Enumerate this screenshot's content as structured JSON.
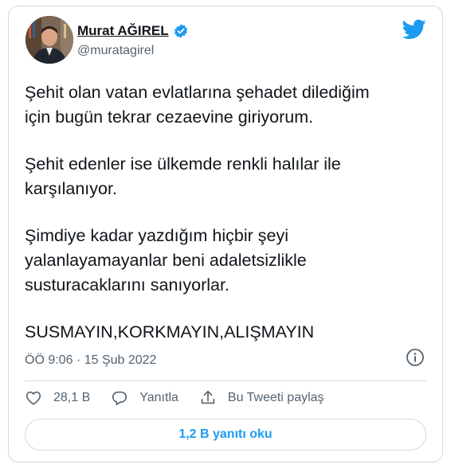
{
  "tweet": {
    "author_name": "Murat AĞIREL",
    "handle": "@muratagirel",
    "paragraphs": [
      "Şehit olan vatan evlatlarına şehadet dilediğim\niçin bugün tekrar cezaevine giriyorum.",
      "Şehit edenler ise ülkemde renkli halılar ile\nkarşılanıyor.",
      "Şimdiye kadar yazdığım hiçbir şeyi\nyalanlayamayanlar beni adaletsizlikle\nsusturacaklarını sanıyorlar.",
      "SUSMAYIN,KORKMAYIN,ALIŞMAYIN"
    ],
    "timestamp": "ÖÖ 9:06 · 15 Şub 2022",
    "likes": "28,1 B",
    "reply_label": "Yanıtla",
    "share_label": "Bu Tweeti paylaş",
    "replies_button": "1,2 B yanıtı oku"
  },
  "colors": {
    "accent": "#1d9bf0",
    "text": "#0f1419",
    "muted": "#536471",
    "border": "#cfd9de"
  },
  "icons": [
    "verified-badge-icon",
    "twitter-bird-icon",
    "info-icon",
    "heart-icon",
    "reply-icon",
    "share-icon"
  ]
}
